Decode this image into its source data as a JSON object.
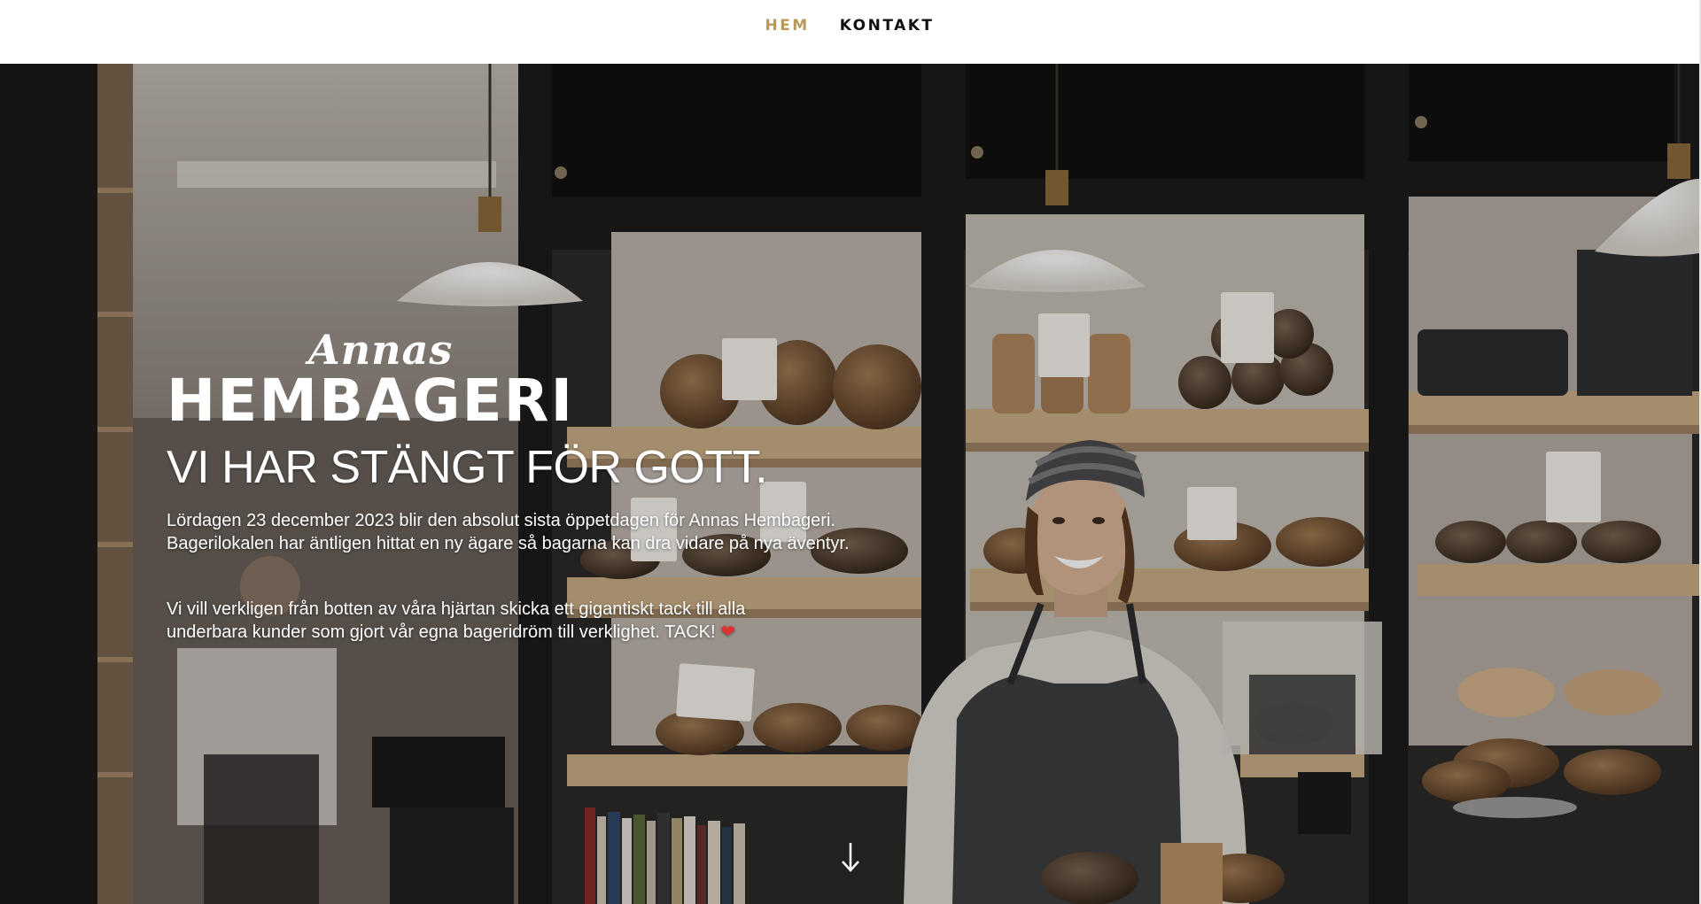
{
  "nav": {
    "items": [
      {
        "label": "HEM",
        "active": true
      },
      {
        "label": "KONTAKT",
        "active": false
      }
    ],
    "active_color": "#b99a5c"
  },
  "hero": {
    "logo_script": "Annas",
    "logo_main": "HEMBAGERI",
    "headline": "VI HAR STÄNGT FÖR GOTT.",
    "paragraph_1": "Lördagen 23 december 2023 blir den absolut sista öppetdagen för Annas Hembageri.\nBagerilokalen har äntligen hittat en ny ägare så bagarna kan dra vidare på nya äventyr.",
    "paragraph_2": "Vi vill verkligen från botten av våra hjärtan skicka ett gigantiskt tack till alla\nunderbara kunder som gjort vår egna bageridröm till verklighet. TACK!",
    "heart": "❤",
    "scroll_icon": "arrow-down-icon"
  }
}
